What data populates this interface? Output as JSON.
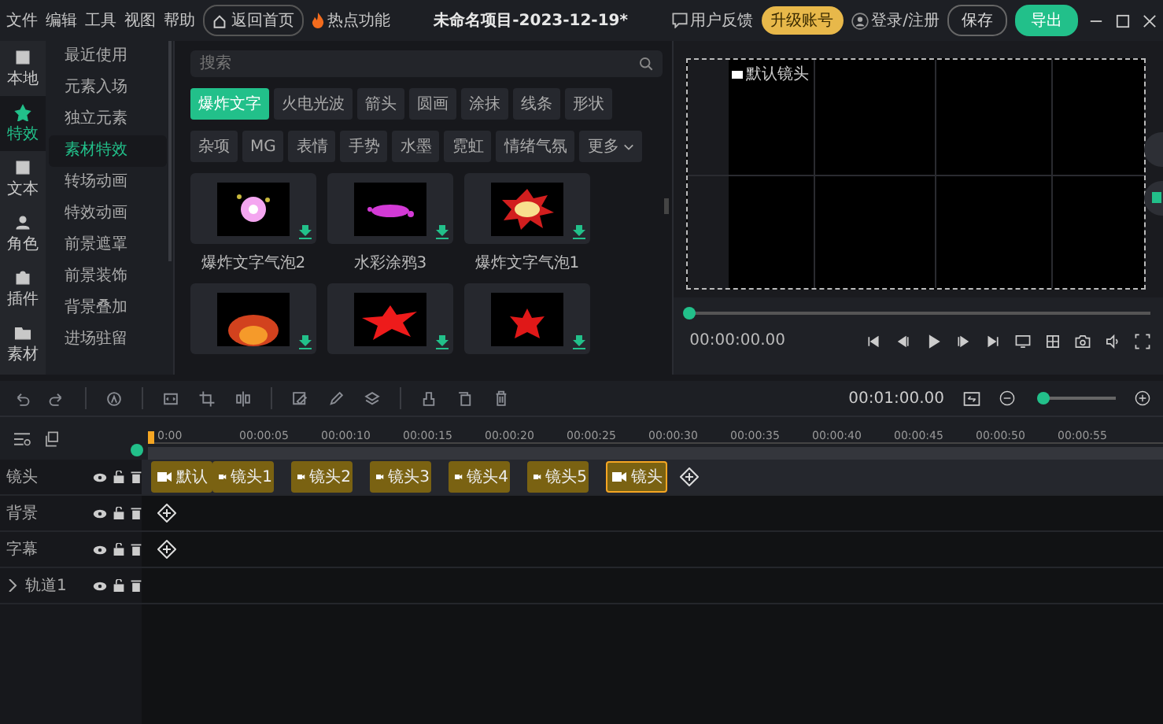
{
  "menu": [
    "文件",
    "编辑",
    "工具",
    "视图",
    "帮助"
  ],
  "home_button": "返回首页",
  "hot_features": "热点功能",
  "project_title": "未命名项目-2023-12-19*",
  "feedback": "用户反馈",
  "upgrade": "升级账号",
  "login": "登录/注册",
  "save": "保存",
  "export": "导出",
  "rail": [
    {
      "label": "本地",
      "selected": false
    },
    {
      "label": "特效",
      "selected": true
    },
    {
      "label": "文本",
      "selected": false
    },
    {
      "label": "角色",
      "selected": false
    },
    {
      "label": "插件",
      "selected": false
    },
    {
      "label": "素材",
      "selected": false
    }
  ],
  "categories": [
    {
      "label": "最近使用",
      "selected": false
    },
    {
      "label": "元素入场",
      "selected": false
    },
    {
      "label": "独立元素",
      "selected": false
    },
    {
      "label": "素材特效",
      "selected": true
    },
    {
      "label": "转场动画",
      "selected": false
    },
    {
      "label": "特效动画",
      "selected": false
    },
    {
      "label": "前景遮罩",
      "selected": false
    },
    {
      "label": "前景装饰",
      "selected": false
    },
    {
      "label": "背景叠加",
      "selected": false
    },
    {
      "label": "进场驻留",
      "selected": false
    }
  ],
  "search": {
    "placeholder": "搜索"
  },
  "tag_rows": [
    [
      {
        "label": "爆炸文字",
        "kind": "tag",
        "selected": true
      },
      {
        "label": "火电光波",
        "kind": "tag",
        "selected": false
      },
      {
        "label": "箭头",
        "kind": "tag",
        "selected": false
      },
      {
        "label": "圆画",
        "kind": "tag",
        "selected": false
      },
      {
        "label": "涂抹",
        "kind": "tag",
        "selected": false
      },
      {
        "label": "线条",
        "kind": "tag",
        "selected": false
      },
      {
        "label": "形状",
        "kind": "tag",
        "selected": false
      }
    ],
    [
      {
        "label": "杂项",
        "kind": "tag",
        "selected": false
      },
      {
        "label": "MG",
        "kind": "tag",
        "selected": false
      },
      {
        "label": "表情",
        "kind": "tag",
        "selected": false
      },
      {
        "label": "手势",
        "kind": "tag",
        "selected": false
      },
      {
        "label": "水墨",
        "kind": "tag",
        "selected": false
      },
      {
        "label": "霓虹",
        "kind": "tag",
        "selected": false
      },
      {
        "label": "情绪气氛",
        "kind": "tag",
        "selected": false
      },
      {
        "label": "更多",
        "kind": "dropdown",
        "selected": false
      }
    ]
  ],
  "items": [
    {
      "label": "爆炸文字气泡2",
      "kind": "flower"
    },
    {
      "label": "水彩涂鸦3",
      "kind": "splash"
    },
    {
      "label": "爆炸文字气泡1",
      "kind": "bubble"
    },
    {
      "kind": "fire"
    },
    {
      "kind": "burst"
    },
    {
      "kind": "blob"
    }
  ],
  "preview": {
    "camera_label": "默认镜头",
    "time": "00:00:00.00",
    "level": 0
  },
  "timeline": {
    "duration": "00:01:00.00",
    "zoom_level": {
      "level": 0.04
    },
    "ticks": [
      "0:00",
      "00:00:05",
      "00:00:10",
      "00:00:15",
      "00:00:20",
      "00:00:25",
      "00:00:30",
      "00:00:35",
      "00:00:40",
      "00:00:45",
      "00:00:50",
      "00:00:55"
    ],
    "tracks": [
      {
        "name": "镜头",
        "kind": "camera",
        "clips": [
          {
            "label": "默认",
            "selected": false
          },
          {
            "label": "镜头1",
            "selected": false
          },
          {
            "label": "镜头2",
            "selected": false
          },
          {
            "label": "镜头3",
            "selected": false
          },
          {
            "label": "镜头4",
            "selected": false
          },
          {
            "label": "镜头5",
            "selected": false
          },
          {
            "label": "镜头",
            "selected": true
          }
        ]
      },
      {
        "name": "背景",
        "kind": "add"
      },
      {
        "name": "字幕",
        "kind": "add"
      },
      {
        "name": "轨道1",
        "kind": "group",
        "expanded": false
      }
    ]
  }
}
